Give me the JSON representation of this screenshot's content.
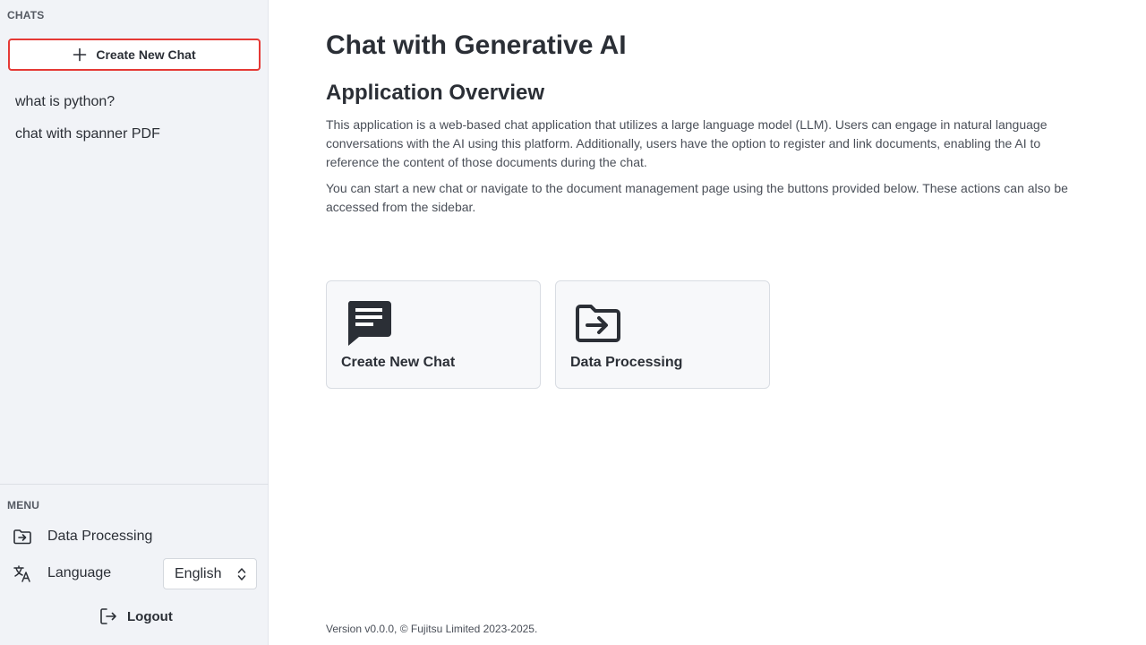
{
  "sidebar": {
    "chats_label": "CHATS",
    "new_chat_button": "Create New Chat",
    "chat_history": [
      {
        "title": "what is python?"
      },
      {
        "title": "chat with spanner PDF"
      }
    ],
    "menu_label": "MENU",
    "menu_items": {
      "data_processing": "Data Processing",
      "language": "Language"
    },
    "language_select": {
      "selected": "English"
    },
    "logout": "Logout"
  },
  "main": {
    "title": "Chat with Generative AI",
    "overview_heading": "Application Overview",
    "paragraphs": [
      "This application is a web-based chat application that utilizes a large language model (LLM). Users can engage in natural language conversations with the AI using this platform. Additionally, users have the option to register and link documents, enabling the AI to reference the content of those documents during the chat.",
      "You can start a new chat or navigate to the document management page using the buttons provided below. These actions can also be accessed from the sidebar."
    ],
    "cards": {
      "new_chat": {
        "label": "Create New Chat",
        "icon": "chat-message-icon"
      },
      "data_processing": {
        "label": "Data Processing",
        "icon": "folder-import-icon"
      }
    },
    "footer": "Version v0.0.0, © Fujitsu Limited 2023-2025."
  },
  "colors": {
    "sidebar_bg": "#f1f3f7",
    "highlight_border": "#e53935",
    "text": "#2b2f36",
    "card_bg": "#f7f8fa"
  }
}
